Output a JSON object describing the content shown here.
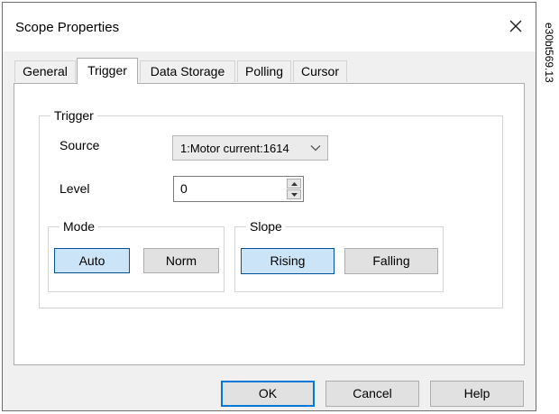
{
  "dialog": {
    "title": "Scope Properties",
    "close_icon": "close-icon"
  },
  "tabs": [
    {
      "label": "General",
      "active": false
    },
    {
      "label": "Trigger",
      "active": true
    },
    {
      "label": "Data Storage",
      "active": false
    },
    {
      "label": "Polling",
      "active": false
    },
    {
      "label": "Cursor",
      "active": false
    }
  ],
  "trigger": {
    "group_label": "Trigger",
    "source_label": "Source",
    "source_value": "1:Motor current:1614",
    "level_label": "Level",
    "level_value": "0",
    "mode": {
      "group_label": "Mode",
      "auto_label": "Auto",
      "norm_label": "Norm",
      "selected": "Auto"
    },
    "slope": {
      "group_label": "Slope",
      "rising_label": "Rising",
      "falling_label": "Falling",
      "selected": "Rising"
    }
  },
  "footer": {
    "ok_label": "OK",
    "cancel_label": "Cancel",
    "help_label": "Help"
  },
  "side_code": "e30bt569.13",
  "colors": {
    "dialog_bg": "#f0f0f0",
    "selected_button_bg": "#cce4f7",
    "selected_button_border": "#005499",
    "default_button_border": "#0078d7"
  }
}
